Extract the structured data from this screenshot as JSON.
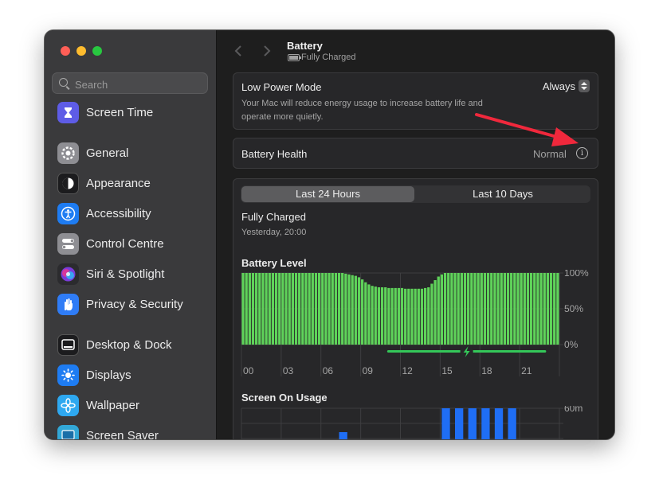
{
  "window": {
    "traffic_lights": {
      "close": "#ff5f57",
      "minimize": "#febc2e",
      "zoom": "#28c840"
    }
  },
  "sidebar": {
    "search_placeholder": "Search",
    "items": [
      {
        "label": "Screen Time",
        "icon": "hourglass-icon",
        "color": "#5e5ce6"
      },
      {
        "label": "General",
        "icon": "gear-icon",
        "color": "#8e8e93"
      },
      {
        "label": "Appearance",
        "icon": "appearance-icon",
        "color": "#1c1c1e"
      },
      {
        "label": "Accessibility",
        "icon": "accessibility-icon",
        "color": "#1e7cf2"
      },
      {
        "label": "Control Centre",
        "icon": "control-centre-icon",
        "color": "#8e8e93"
      },
      {
        "label": "Siri & Spotlight",
        "icon": "siri-icon",
        "color": "#2b2b2e"
      },
      {
        "label": "Privacy & Security",
        "icon": "hand-icon",
        "color": "#2f7cf6"
      },
      {
        "label": "Desktop & Dock",
        "icon": "dock-icon",
        "color": "#1c1c1e"
      },
      {
        "label": "Displays",
        "icon": "sun-icon",
        "color": "#1e7cf2"
      },
      {
        "label": "Wallpaper",
        "icon": "flower-icon",
        "color": "#2ea8f0"
      },
      {
        "label": "Screen Saver",
        "icon": "screen-saver-icon",
        "color": "#32a7d6"
      }
    ]
  },
  "header": {
    "title": "Battery",
    "subtitle": "Fully Charged"
  },
  "low_power": {
    "label": "Low Power Mode",
    "value": "Always",
    "description_line1": "Your Mac will reduce energy usage to increase battery life and",
    "description_line2": "operate more quietly."
  },
  "battery_health": {
    "label": "Battery Health",
    "value": "Normal",
    "info_glyph": "i"
  },
  "usage": {
    "tabs": [
      {
        "label": "Last 24 Hours",
        "selected": true
      },
      {
        "label": "Last 10 Days",
        "selected": false
      }
    ],
    "status": "Fully Charged",
    "status_time": "Yesterday, 20:00",
    "battery_level_title": "Battery Level",
    "screen_on_title": "Screen On Usage",
    "colors": {
      "battery_bar": "#5fd35a",
      "charging_line": "#34c759",
      "usage_bar": "#1f6ef5"
    }
  },
  "annotation": {
    "arrow_color": "#f0283c"
  },
  "chart_data": [
    {
      "type": "bar",
      "title": "Battery Level",
      "x_tick_labels": [
        "00",
        "03",
        "06",
        "09",
        "12",
        "15",
        "18",
        "21"
      ],
      "y_tick_labels": [
        "100%",
        "50%",
        "0%"
      ],
      "ylim": [
        0,
        100
      ],
      "series": [
        {
          "values": [
            100,
            100,
            100,
            100,
            100,
            100,
            100,
            100,
            100,
            100,
            100,
            100,
            100,
            100,
            100,
            100,
            100,
            100,
            100,
            100,
            100,
            100,
            100,
            100,
            100,
            100,
            100,
            100,
            100,
            100,
            100,
            99,
            98,
            97,
            96,
            94,
            91,
            87,
            84,
            82,
            81,
            80,
            80,
            80,
            79,
            79,
            79,
            79,
            79,
            78,
            78,
            78,
            78,
            78,
            78,
            79,
            80,
            85,
            90,
            95,
            98,
            100,
            100,
            100,
            100,
            100,
            100,
            100,
            100,
            100,
            100,
            100,
            100,
            100,
            100,
            100,
            100,
            100,
            100,
            100,
            100,
            100,
            100,
            100,
            100,
            100,
            100,
            100,
            100,
            100,
            100,
            100,
            100,
            100,
            100,
            100
          ]
        }
      ],
      "charging_range_hours": [
        11,
        23
      ],
      "grid": true
    },
    {
      "type": "bar",
      "title": "Screen On Usage",
      "y_tick_labels": [
        "60m"
      ],
      "ylim": [
        0,
        60
      ],
      "series": [
        {
          "values": [
            0,
            0,
            0,
            0,
            0,
            0,
            0,
            0,
            0,
            0,
            0,
            0,
            0,
            0,
            0,
            0,
            0,
            0,
            0,
            0,
            0,
            0,
            0,
            0,
            0,
            0,
            0,
            0,
            0,
            0,
            0,
            0,
            0,
            0,
            0,
            0,
            0,
            0,
            0,
            0,
            0,
            0,
            0,
            0,
            0,
            0,
            0,
            0,
            0,
            0,
            0,
            0,
            0,
            0,
            0,
            0,
            0,
            0,
            0,
            0,
            0,
            0,
            0,
            0,
            0,
            0,
            0,
            0,
            0,
            0,
            0,
            0,
            0,
            0,
            0,
            0,
            0,
            0,
            0,
            0,
            0,
            0,
            0,
            0,
            0,
            0,
            0,
            0,
            0,
            0,
            0,
            0,
            0,
            0,
            0,
            0
          ]
        }
      ],
      "bars_hours": [
        7.25,
        15,
        16,
        17,
        18,
        19,
        20
      ],
      "bars_minutes": [
        35,
        60,
        60,
        60,
        60,
        60,
        60
      ],
      "grid": true
    }
  ]
}
